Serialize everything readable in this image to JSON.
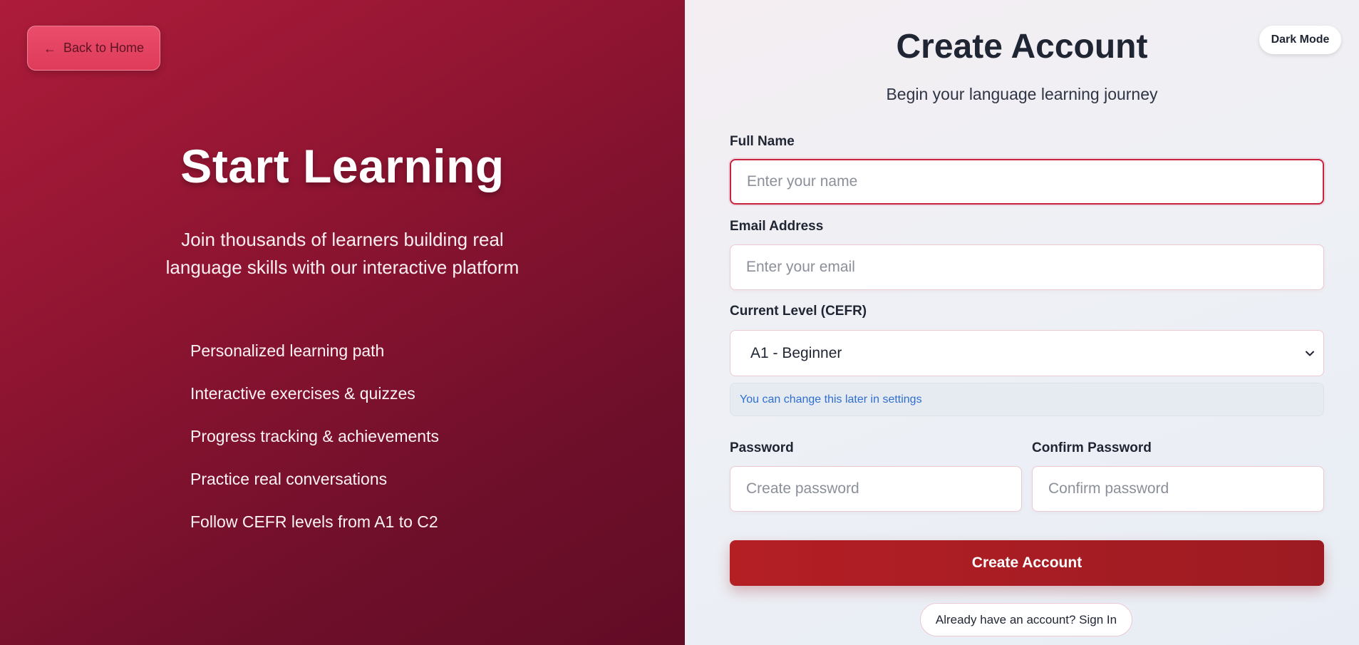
{
  "left_panel": {
    "back_label": "Back to Home",
    "back_arrow": "←",
    "title": "Start Learning",
    "subtitle": "Join thousands of learners building real language skills with our interactive platform",
    "features": [
      "Personalized learning path",
      "Interactive exercises & quizzes",
      "Progress tracking & achievements",
      "Practice real conversations",
      "Follow CEFR levels from A1 to C2"
    ]
  },
  "right_panel": {
    "dark_mode_label": "Dark Mode",
    "title": "Create Account",
    "subtitle": "Begin your language learning journey",
    "fields": {
      "full_name": {
        "label": "Full Name",
        "placeholder": "Enter your name",
        "value": ""
      },
      "email": {
        "label": "Email Address",
        "placeholder": "Enter your email",
        "value": ""
      },
      "level": {
        "label": "Current Level (CEFR)",
        "selected": "A1 - Beginner",
        "hint": "You can change this later in settings"
      },
      "password": {
        "label": "Password",
        "placeholder": "Create password",
        "value": ""
      },
      "confirm_password": {
        "label": "Confirm Password",
        "placeholder": "Confirm password",
        "value": ""
      }
    },
    "submit_label": "Create Account",
    "signin_label": "Already have an account? Sign In"
  },
  "colors": {
    "brand": "#9c1b22",
    "left_bg": "#8c1431",
    "focus_border": "#c8243f",
    "hint_text": "#2f6fd0"
  },
  "icons": {
    "back": "arrow-left-icon",
    "select": "chevron-down-icon"
  }
}
